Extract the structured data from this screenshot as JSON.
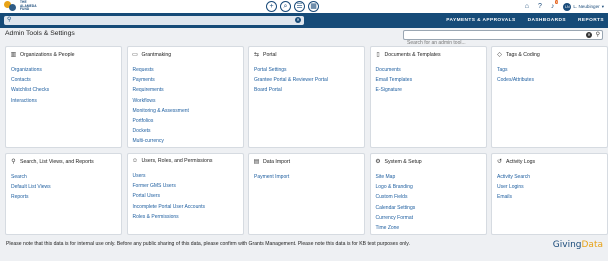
{
  "topbar": {
    "logo_line1": "THE",
    "logo_line2": "ALAMEDA",
    "logo_line3": "FUND",
    "circle_buttons": [
      "+",
      "⌕",
      "☰",
      "▦"
    ],
    "icons": [
      "home-icon",
      "help-icon",
      "bell-icon",
      "user-icon"
    ],
    "notification_count": "9",
    "user_name": "L. Neubinger",
    "user_initials": "LN"
  },
  "navbar": {
    "search_placeholder": "",
    "links": [
      "PAYMENTS & APPROVALS",
      "DASHBOARDS",
      "REPORTS"
    ]
  },
  "page": {
    "title": "Admin Tools & Settings",
    "admin_search_placeholder": "Search for an admin tool..."
  },
  "cards": [
    {
      "title": "Organizations & People",
      "icon": "building-icon",
      "items": [
        "Organizations",
        "Contacts",
        "Watchlist Checks",
        "Interactions"
      ]
    },
    {
      "title": "Grantmaking",
      "icon": "folder-icon",
      "items": [
        "Requests",
        "Payments",
        "Requirements",
        "Workflows",
        "Monitoring & Assessment",
        "Portfolios",
        "Dockets",
        "Multi-currency"
      ]
    },
    {
      "title": "Portal",
      "icon": "portal-icon",
      "items": [
        "Portal Settings",
        "Grantee Portal & Reviewer Portal",
        "Board Portal"
      ]
    },
    {
      "title": "Documents & Templates",
      "icon": "document-icon",
      "items": [
        "Documents",
        "Email Templates",
        "E-Signature"
      ]
    },
    {
      "title": "Tags & Coding",
      "icon": "tag-icon",
      "items": [
        "Tags",
        "Codes/Attributes"
      ]
    },
    {
      "title": "Search, List Views, and Reports",
      "icon": "search-icon",
      "items": [
        "Search",
        "Default List Views",
        "Reports"
      ]
    },
    {
      "title": "Users, Roles, and Permissions",
      "icon": "users-icon",
      "items": [
        "Users",
        "Former GMS Users",
        "Portal Users",
        "Incomplete Portal User Accounts",
        "Roles & Permissions"
      ]
    },
    {
      "title": "Data Import",
      "icon": "import-icon",
      "items": [
        "Payment Import"
      ]
    },
    {
      "title": "System & Setup",
      "icon": "gear-icon",
      "items": [
        "Site Map",
        "Logo & Branding",
        "Custom Fields",
        "Calendar Settings",
        "Currency Format",
        "Time Zone"
      ]
    },
    {
      "title": "Activity Logs",
      "icon": "history-icon",
      "items": [
        "Activity Search",
        "User Logins",
        "Emails"
      ]
    }
  ],
  "footer": {
    "note": "Please note that this data is for internal use only. Before any public sharing of this data, please confirm with Grants Management. Please note this data is for KB test purposes only.",
    "brand_part1": "Giving",
    "brand_part2": "Data"
  }
}
